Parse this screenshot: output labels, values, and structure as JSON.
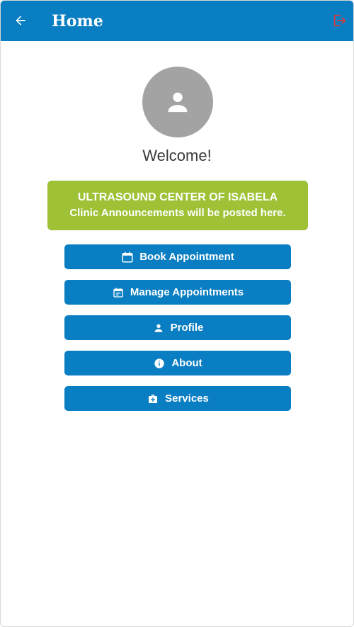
{
  "appbar": {
    "title": "Home",
    "back_icon": "arrow-left-icon",
    "logout_icon": "logout-icon",
    "bar_color": "#0a7ec2",
    "logout_color": "#e53935"
  },
  "profile": {
    "avatar_icon": "person-icon",
    "welcome": "Welcome!"
  },
  "announcement": {
    "title": "ULTRASOUND CENTER OF ISABELA",
    "message": "Clinic Announcements will be posted here.",
    "color": "#9ec135"
  },
  "menu": [
    {
      "label": "Book Appointment",
      "icon": "calendar-icon"
    },
    {
      "label": "Manage Appointments",
      "icon": "calendar-event-icon"
    },
    {
      "label": "Profile",
      "icon": "person-icon"
    },
    {
      "label": "About",
      "icon": "info-icon"
    },
    {
      "label": "Services",
      "icon": "medical-bag-icon"
    }
  ]
}
